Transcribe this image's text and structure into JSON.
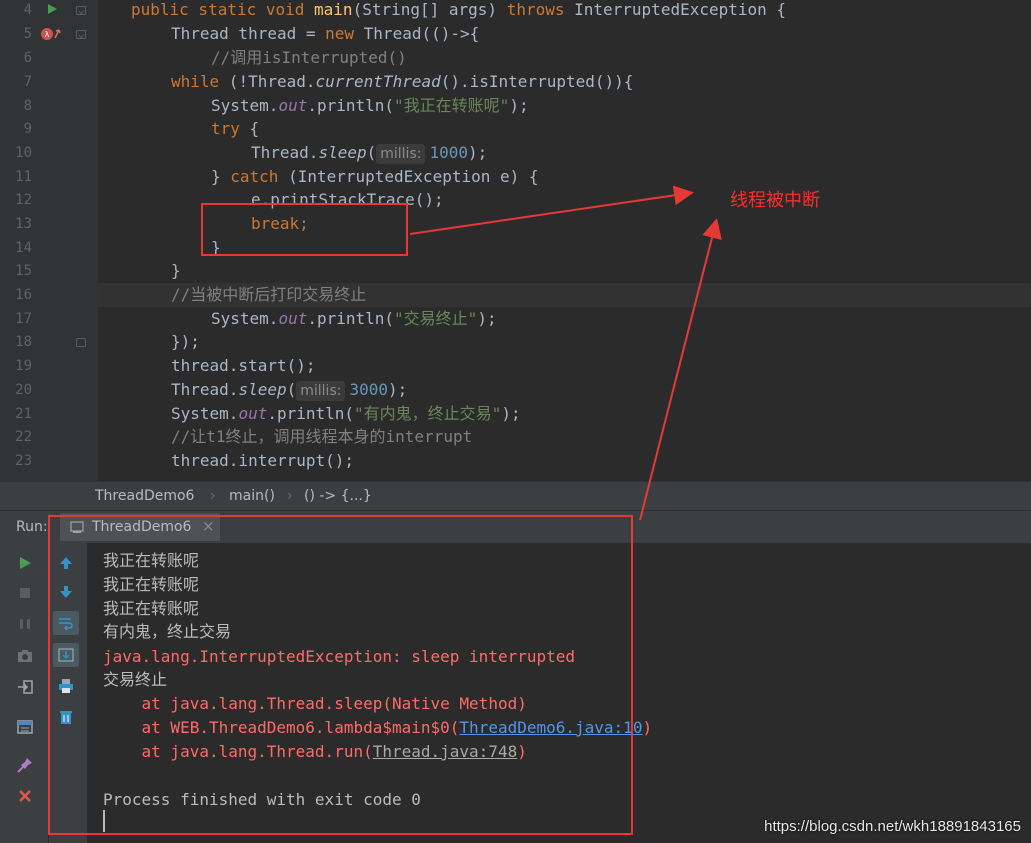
{
  "editor": {
    "line_numbers": [
      "4",
      "5",
      "6",
      "7",
      "8",
      "9",
      "10",
      "11",
      "12",
      "13",
      "14",
      "15",
      "16",
      "17",
      "18",
      "19",
      "20",
      "21",
      "22",
      "23"
    ],
    "hints": {
      "millis_label_1": "millis:",
      "millis_label_2": "millis:"
    },
    "line_4": {
      "kw1": "public static void ",
      "fn": "main",
      "rest": "(String[] args) ",
      "kw2": "throws",
      "tail": " InterruptedException {"
    },
    "line_5": {
      "a": "Thread thread = ",
      "kw": "new",
      "b": " Thread(()->{"
    },
    "line_6": {
      "comment": "//调用isInterrupted()"
    },
    "line_7": {
      "kw": "while",
      "a": " (!Thread.",
      "it": "currentThread",
      "b": "().isInterrupted()){"
    },
    "line_8": {
      "a": "System.",
      "fld": "out",
      "b": ".println(",
      "str": "\"我正在转账呢\"",
      "c": ");"
    },
    "line_9": {
      "kw": "try",
      "b": " {"
    },
    "line_10": {
      "a": "Thread.",
      "it": "sleep",
      "b": "(",
      "num": "1000",
      "c": ");"
    },
    "line_11": {
      "a": "} ",
      "kw": "catch",
      "b": " (InterruptedException e) {"
    },
    "line_12": {
      "a": "e.printStackTrace();"
    },
    "line_13": {
      "kw": "break",
      "b": ";"
    },
    "line_14": {
      "a": "}"
    },
    "line_15": {
      "a": "}"
    },
    "line_16": {
      "comment": "//当被中断后打印交易终止"
    },
    "line_17": {
      "a": "System.",
      "fld": "out",
      "b": ".println(",
      "str": "\"交易终止\"",
      "c": ");"
    },
    "line_18": {
      "a": "});"
    },
    "line_19": {
      "a": "thread.start();"
    },
    "line_20": {
      "a": "Thread.",
      "it": "sleep",
      "b": "(",
      "num": "3000",
      "c": ");"
    },
    "line_21": {
      "a": "System.",
      "fld": "out",
      "b": ".println(",
      "str": "\"有内鬼，终止交易\"",
      "c": ");"
    },
    "line_22": {
      "comment": "//让t1终止，调用线程本身的interrupt"
    },
    "line_23": {
      "a": "thread.interrupt();"
    }
  },
  "breadcrumb": {
    "file": "ThreadDemo6",
    "method": "main()",
    "lambda": "() -> {...}",
    "sep": "›"
  },
  "run_panel": {
    "label": "Run:",
    "tab_title": "ThreadDemo6",
    "tab_close": "×",
    "output": [
      {
        "text": "我正在转账呢",
        "type": "normal"
      },
      {
        "text": "我正在转账呢",
        "type": "normal"
      },
      {
        "text": "我正在转账呢",
        "type": "normal"
      },
      {
        "text": "有内鬼，终止交易",
        "type": "normal"
      },
      {
        "text": "java.lang.InterruptedException: sleep interrupted",
        "type": "error"
      },
      {
        "text": "交易终止",
        "type": "normal"
      }
    ],
    "trace_1": "    at java.lang.Thread.sleep(Native Method)",
    "trace_2_prefix": "    at WEB.ThreadDemo6.lambda$main$0(",
    "trace_2_link": "ThreadDemo6.java:10",
    "trace_2_suffix": ")",
    "trace_3_prefix": "    at java.lang.Thread.run(",
    "trace_3_link": "Thread.java:748",
    "trace_3_suffix": ")",
    "exit_message": "Process finished with exit code 0",
    "tool_icons_left": [
      "run-icon",
      "stop-icon",
      "pause-icon",
      "camera-icon",
      "exit-icon",
      "layout-icon",
      "pin-icon",
      "close-icon"
    ],
    "tool_icons_right": [
      "up-arrow-icon",
      "down-arrow-icon",
      "soft-wrap-icon",
      "scroll-to-end-icon",
      "print-icon",
      "trash-icon"
    ]
  },
  "annotation": {
    "label": "线程被中断",
    "color": "#ff2d2d"
  },
  "watermark": "https://blog.csdn.net/wkh18891843165",
  "colors": {
    "keyword": "#cc7832",
    "method": "#ffc66d",
    "string": "#6a8759",
    "number": "#6897bb",
    "comment": "#808080",
    "field": "#9876aa",
    "error": "#ff6b68",
    "link": "#5394ec"
  }
}
